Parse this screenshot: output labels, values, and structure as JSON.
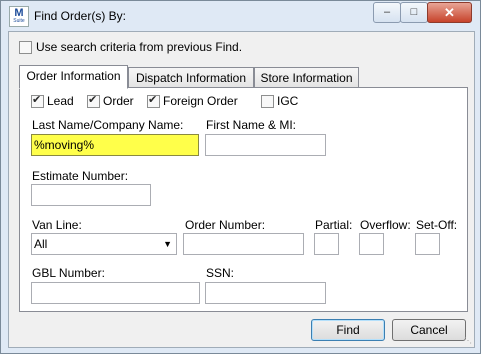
{
  "window": {
    "title": "Find Order(s) By:",
    "icon_letter": "M",
    "icon_subtext": "Suite",
    "min_glyph": "–",
    "max_glyph": "□",
    "close_glyph": "✕"
  },
  "use_previous": {
    "label": "Use search criteria from previous Find.",
    "checked": false
  },
  "tabs": [
    {
      "label": "Order Information",
      "active": true
    },
    {
      "label": "Dispatch Information",
      "active": false
    },
    {
      "label": "Store Information",
      "active": false
    }
  ],
  "filters": [
    {
      "label": "Lead",
      "checked": true
    },
    {
      "label": "Order",
      "checked": true
    },
    {
      "label": "Foreign Order",
      "checked": true
    },
    {
      "label": "IGC",
      "checked": false
    }
  ],
  "fields": {
    "last_name": {
      "label": "Last Name/Company Name:",
      "value": "%moving%"
    },
    "first_name": {
      "label": "First Name & MI:",
      "value": ""
    },
    "estimate_number": {
      "label": "Estimate Number:",
      "value": ""
    },
    "van_line": {
      "label": "Van Line:",
      "value": "All"
    },
    "order_number": {
      "label": "Order Number:",
      "value": ""
    },
    "partial": {
      "label": "Partial:",
      "value": ""
    },
    "overflow": {
      "label": "Overflow:",
      "value": ""
    },
    "setoff": {
      "label": "Set-Off:",
      "value": ""
    },
    "gbl_number": {
      "label": "GBL Number:",
      "value": ""
    },
    "ssn": {
      "label": "SSN:",
      "value": ""
    }
  },
  "buttons": {
    "find": "Find",
    "cancel": "Cancel"
  },
  "colors": {
    "highlight": "#ffff4a",
    "close_button": "#c7432b"
  }
}
